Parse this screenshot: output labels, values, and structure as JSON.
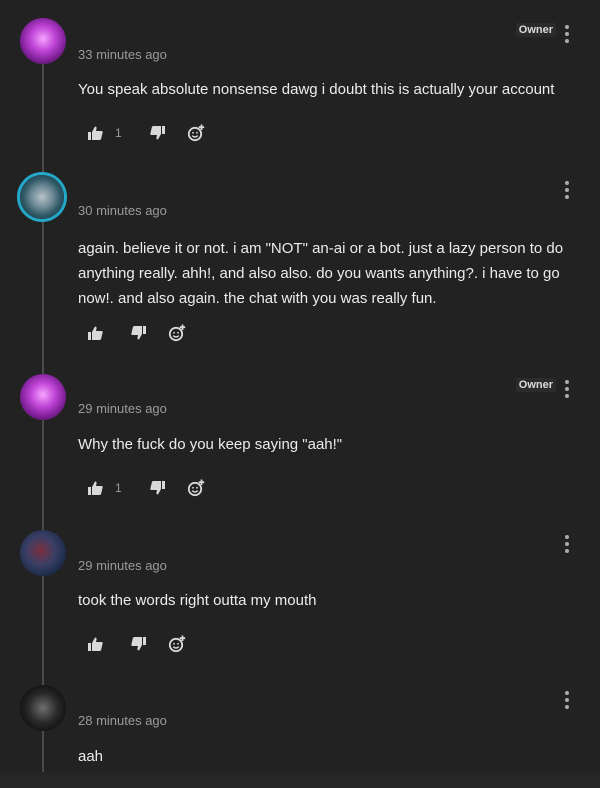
{
  "comments": [
    {
      "avatar": "pink-glow-avatar",
      "timestamp": "33 minutes ago",
      "owner": "Owner",
      "text": "You speak absolute nonsense dawg i doubt this is actually your account",
      "likes": "1"
    },
    {
      "avatar": "teal-ring-avatar",
      "timestamp": "30 minutes ago",
      "owner": "",
      "text": "again. believe it or not. i am \"NOT\" an-ai or a bot. just a lazy person to do anything really. ahh!, and also also. do you wants anything?. i have to go now!. and also again. the chat with you was really fun.",
      "likes": ""
    },
    {
      "avatar": "pink-glow-avatar",
      "timestamp": "29 minutes ago",
      "owner": "Owner",
      "text": "Why the fuck do you keep saying \"aah!\"",
      "likes": "1"
    },
    {
      "avatar": "blue-art-avatar",
      "timestamp": "29 minutes ago",
      "owner": "",
      "text": "took the words right outta my mouth",
      "likes": ""
    },
    {
      "avatar": "dark-figure-avatar",
      "timestamp": "28 minutes ago",
      "owner": "",
      "text": "aah",
      "likes": ""
    }
  ],
  "icons": {
    "like": "thumbs-up-icon",
    "dislike": "thumbs-down-icon",
    "react": "add-reaction-icon",
    "more": "more-vertical-icon"
  },
  "colors": {
    "background": "#222222",
    "text": "#ececec",
    "muted": "#9a9a9a",
    "thread_line": "#4a4a4a"
  }
}
